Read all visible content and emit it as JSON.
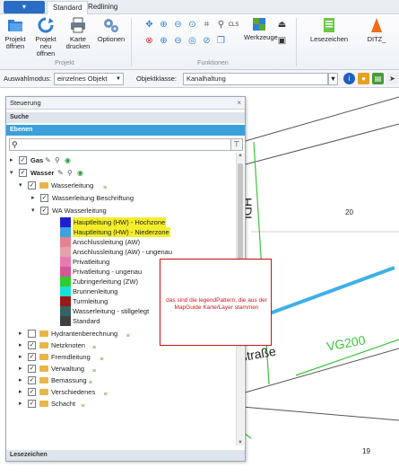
{
  "ribbon": {
    "app_menu_label": "",
    "tabs": [
      "Standard",
      "Redlining"
    ],
    "active_tab": "Standard",
    "groups": {
      "projekt": {
        "label": "Projekt",
        "buttons": [
          {
            "label": "Projekt öffnen",
            "icon": "folder-open-icon"
          },
          {
            "label": "Projekt neu öffnen",
            "icon": "refresh-icon"
          },
          {
            "label": "Karte drucken",
            "icon": "printer-icon"
          },
          {
            "label": "Optionen",
            "icon": "gears-icon"
          }
        ]
      },
      "funktionen": {
        "label": "Funktionen",
        "werkzeuge_label": "Werkzeuge",
        "cls_label": "CLS"
      },
      "lesezeichen": {
        "label": "Lesezeichen"
      },
      "ditz": {
        "label": "DITZ_"
      }
    }
  },
  "toolbar": {
    "auswahlmodus_label": "Auswahlmodus:",
    "auswahlmodus_value": "einzelnes Objekt",
    "objektklasse_label": "Objektklasse:",
    "objektklasse_value": "Kanalhaltung"
  },
  "panel": {
    "title": "Steuerung",
    "close_glyph": "×",
    "suche_label": "Suche",
    "ebenen_label": "Ebenen",
    "search_placeholder": "",
    "lesezeichen_label": "Lesezeichen",
    "tree": {
      "gas": "Gas",
      "wasser": "Wasser",
      "wasserleitung": "Wasserleitung",
      "wasserleitung_beschriftung": "Wasserleitung Beschriftung",
      "wa_wasserleitung": "WA Wasserleitung",
      "legend": [
        {
          "label": "Hauptleitung (HW) - Hochzone",
          "color": "#1f1fd1",
          "highlight": true
        },
        {
          "label": "Hauptleitung (HW) - Niederzone",
          "color": "#3fa0e0",
          "highlight": true
        },
        {
          "label": "Anschlussleitung (AW)",
          "color": "#e6828f",
          "highlight": false
        },
        {
          "label": "Anschlussleitung (AW) - ungenau",
          "color": "#e3a2ad",
          "highlight": false
        },
        {
          "label": "Privatleitung",
          "color": "#e77ab0",
          "highlight": false
        },
        {
          "label": "Privatleitung - ungenau",
          "color": "#d65598",
          "highlight": false
        },
        {
          "label": "Zubringerleitung (ZW)",
          "color": "#2ecc2e",
          "highlight": false
        },
        {
          "label": "Brunnenleitung",
          "color": "#1ce0d8",
          "highlight": false
        },
        {
          "label": "Turmleitung",
          "color": "#9a1818",
          "highlight": false
        },
        {
          "label": "Wasserleitung - stillgelegt",
          "color": "#356363",
          "highlight": false
        },
        {
          "label": "Standard",
          "color": "#404040",
          "highlight": false
        }
      ],
      "others": [
        "Hydrantenberechnung",
        "Netzknoten",
        "Fremdleitung",
        "Verwaltung",
        "Bemassung",
        "Verschiedenes",
        "Schacht"
      ]
    }
  },
  "callout": {
    "text": "das sind die legendPattern, die aus der MapGuide Karte/Layer stammen"
  },
  "map": {
    "labels": {
      "hdl": "HDL",
      "num20": "20",
      "strasse": "straße",
      "vg": "VG200",
      "num19": "19"
    }
  }
}
